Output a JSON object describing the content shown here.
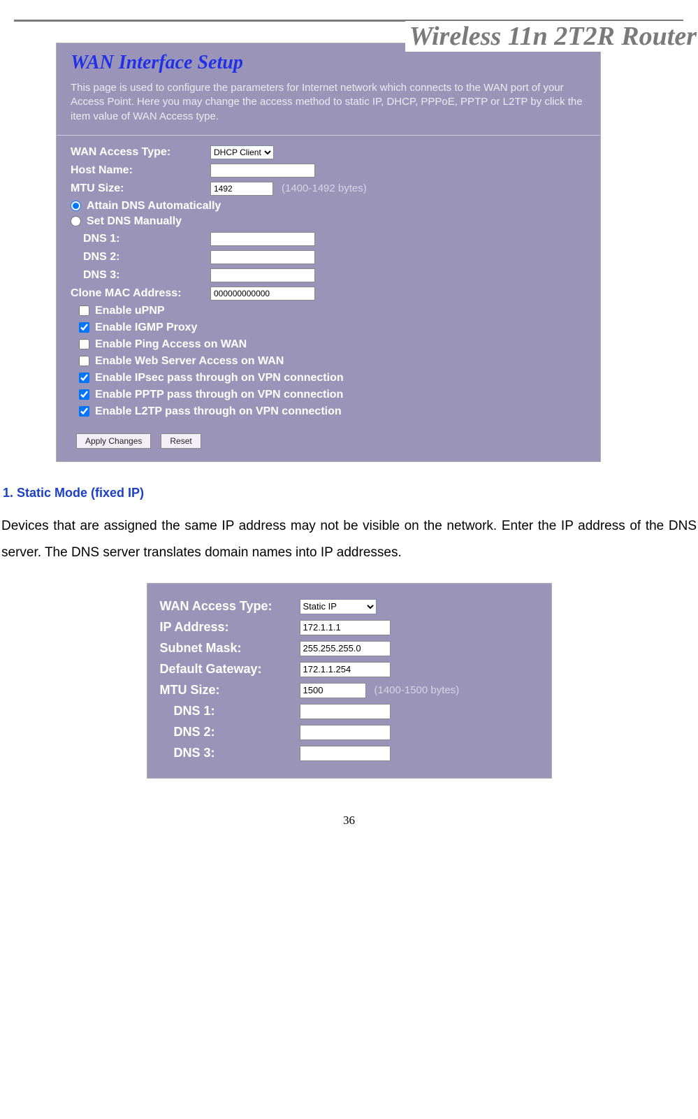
{
  "header": {
    "title": "Wireless 11n 2T2R Router"
  },
  "shot1": {
    "title": "WAN Interface Setup",
    "desc": "This page is used to configure the parameters for Internet network which connects to the WAN port of your Access Point. Here you may change the access method to static IP, DHCP, PPPoE, PPTP or L2TP by click the item value of WAN Access type.",
    "wan_access_type_label": "WAN Access Type:",
    "wan_access_type_value": "DHCP Client",
    "host_name_label": "Host Name:",
    "host_name_value": "",
    "mtu_label": "MTU Size:",
    "mtu_value": "1492",
    "mtu_hint": "(1400-1492 bytes)",
    "radio_auto": "Attain DNS Automatically",
    "radio_manual": "Set DNS Manually",
    "dns1_label": "DNS 1:",
    "dns1_value": "",
    "dns2_label": "DNS 2:",
    "dns2_value": "",
    "dns3_label": "DNS 3:",
    "dns3_value": "",
    "clone_mac_label": "Clone MAC Address:",
    "clone_mac_value": "000000000000",
    "checks": [
      {
        "label": "Enable uPNP",
        "checked": false
      },
      {
        "label": "Enable IGMP Proxy",
        "checked": true
      },
      {
        "label": "Enable Ping Access on WAN",
        "checked": false
      },
      {
        "label": "Enable Web Server Access on WAN",
        "checked": false
      },
      {
        "label": "Enable IPsec pass through on VPN connection",
        "checked": true
      },
      {
        "label": "Enable PPTP pass through on VPN connection",
        "checked": true
      },
      {
        "label": "Enable L2TP pass through on VPN connection",
        "checked": true
      }
    ],
    "btn_apply": "Apply Changes",
    "btn_reset": "Reset"
  },
  "section": {
    "heading": "1. Static Mode (fixed IP)",
    "para": "Devices that are assigned the same IP address may not be visible on the network. Enter the IP address of the DNS server. The DNS server translates domain names into IP addresses."
  },
  "shot2": {
    "wan_access_type_label": "WAN Access Type:",
    "wan_access_type_value": "Static IP",
    "ip_label": "IP Address:",
    "ip_value": "172.1.1.1",
    "mask_label": "Subnet Mask:",
    "mask_value": "255.255.255.0",
    "gw_label": "Default Gateway:",
    "gw_value": "172.1.1.254",
    "mtu_label": "MTU Size:",
    "mtu_value": "1500",
    "mtu_hint": "(1400-1500 bytes)",
    "dns1_label": "DNS 1:",
    "dns1_value": "",
    "dns2_label": "DNS 2:",
    "dns2_value": "",
    "dns3_label": "DNS 3:",
    "dns3_value": ""
  },
  "page_number": "36"
}
